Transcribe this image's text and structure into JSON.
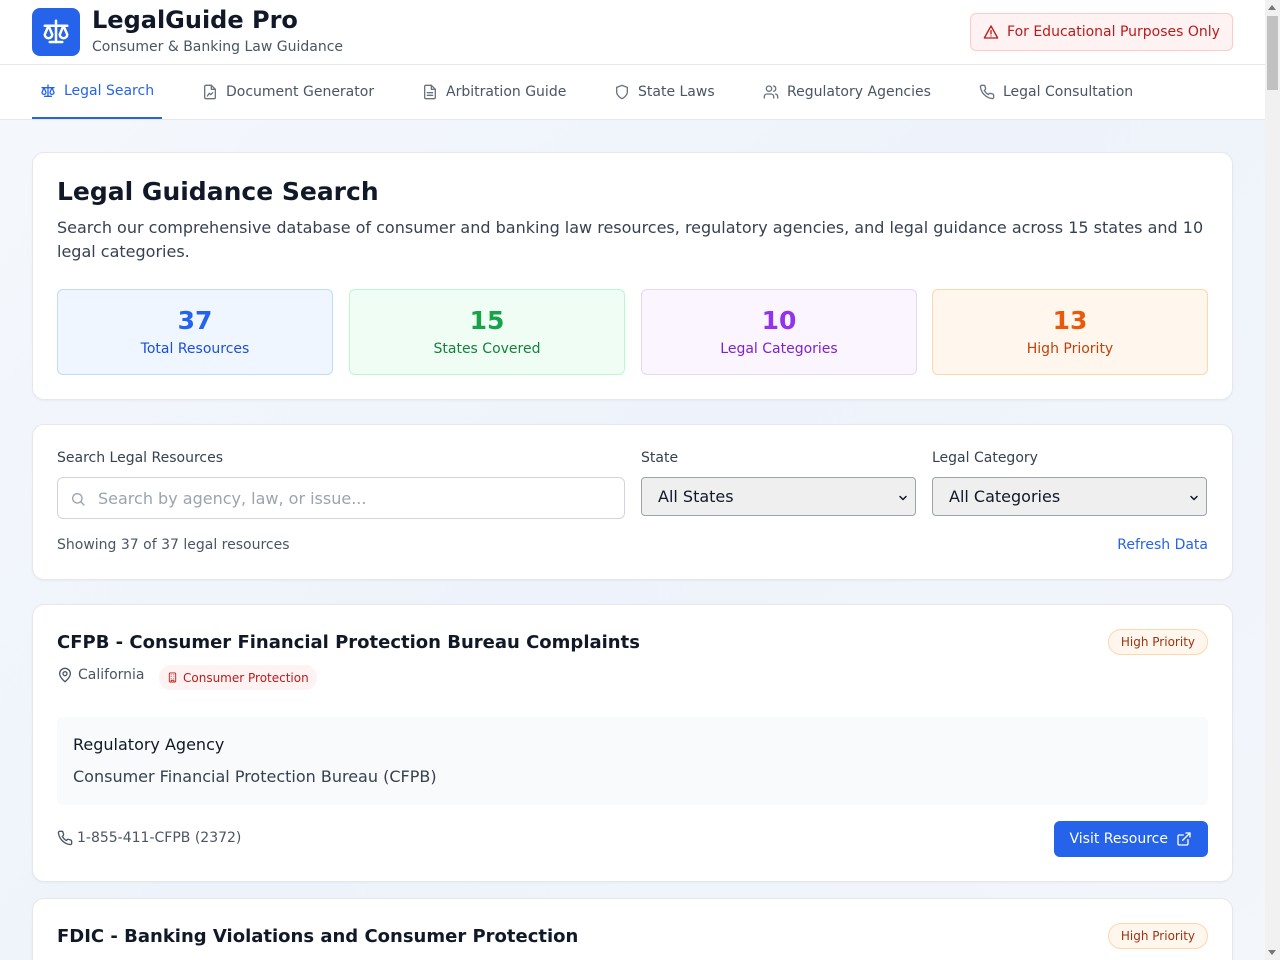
{
  "header": {
    "title": "LegalGuide Pro",
    "subtitle": "Consumer & Banking Law Guidance",
    "badge": "For Educational Purposes Only"
  },
  "nav": {
    "tabs": [
      {
        "label": "Legal Search",
        "icon": "scale-icon",
        "active": true
      },
      {
        "label": "Document Generator",
        "icon": "file-signature-icon",
        "active": false
      },
      {
        "label": "Arbitration Guide",
        "icon": "file-text-icon",
        "active": false
      },
      {
        "label": "State Laws",
        "icon": "shield-icon",
        "active": false
      },
      {
        "label": "Regulatory Agencies",
        "icon": "users-icon",
        "active": false
      },
      {
        "label": "Legal Consultation",
        "icon": "phone-icon",
        "active": false
      }
    ]
  },
  "hero": {
    "title": "Legal Guidance Search",
    "description": "Search our comprehensive database of consumer and banking law resources, regulatory agencies, and legal guidance across 15 states and 10 legal categories.",
    "stats": [
      {
        "value": "37",
        "label": "Total Resources"
      },
      {
        "value": "15",
        "label": "States Covered"
      },
      {
        "value": "10",
        "label": "Legal Categories"
      },
      {
        "value": "13",
        "label": "High Priority"
      }
    ]
  },
  "search": {
    "search_label": "Search Legal Resources",
    "search_placeholder": "Search by agency, law, or issue...",
    "search_value": "",
    "state_label": "State",
    "state_value": "All States",
    "category_label": "Legal Category",
    "category_value": "All Categories",
    "result_count": "Showing 37 of 37 legal resources",
    "refresh_label": "Refresh Data"
  },
  "resources": [
    {
      "title": "CFPB - Consumer Financial Protection Bureau Complaints",
      "priority": "High Priority",
      "state": "California",
      "category": "Consumer Protection",
      "agency_label": "Regulatory Agency",
      "agency": "Consumer Financial Protection Bureau (CFPB)",
      "phone": "1-855-411-CFPB (2372)",
      "button": "Visit Resource"
    },
    {
      "title": "FDIC - Banking Violations and Consumer Protection",
      "priority": "High Priority"
    }
  ],
  "colors": {
    "accent": "#2563eb",
    "danger": "#b91c1c",
    "green": "#16a34a",
    "purple": "#9333ea",
    "orange": "#ea580c"
  }
}
